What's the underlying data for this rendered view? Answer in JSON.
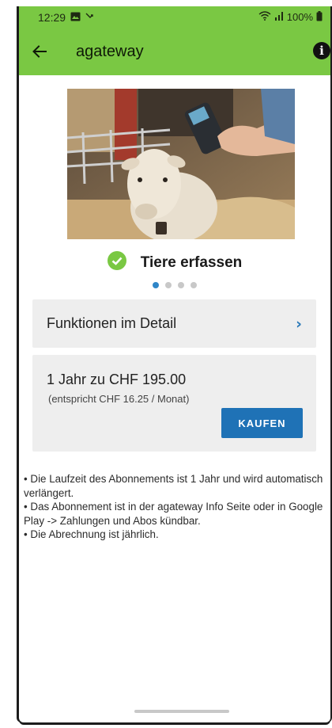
{
  "status": {
    "time": "12:29",
    "battery": "100%"
  },
  "appbar": {
    "title": "agateway",
    "back_icon": "arrow-left-icon",
    "info_icon": "info-icon"
  },
  "carousel": {
    "caption": "Tiere erfassen",
    "page_count": 4,
    "active_index": 0,
    "check_color": "#7ac843"
  },
  "functions_card": {
    "label": "Funktionen im Detail",
    "chevron": "›"
  },
  "subscription": {
    "price": "1 Jahr zu CHF 195.00",
    "monthly": "(entspricht CHF 16.25 / Monat)",
    "buy_label": "KAUFEN"
  },
  "notes": [
    "• Die Laufzeit des Abonnements ist 1 Jahr und wird automatisch verlängert.",
    "• Das Abonnement ist in der agateway Info Seite oder in Google Play -> Zahlungen und Abos kündbar.",
    "• Die Abrechnung ist jährlich."
  ],
  "colors": {
    "accent": "#7ac843",
    "button": "#1f72b6",
    "chevron": "#2b79b8",
    "dot_active": "#2f86c8"
  }
}
